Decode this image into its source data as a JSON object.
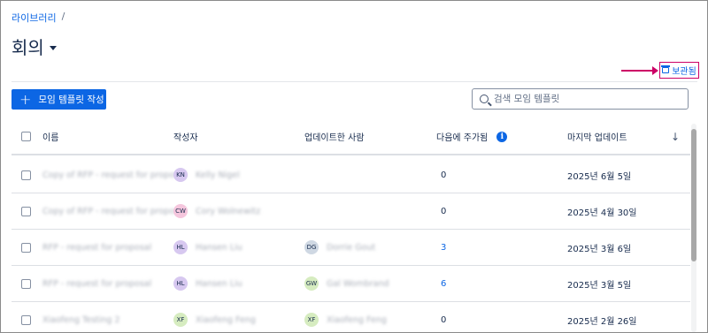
{
  "breadcrumb": {
    "library": "라이브러리",
    "separator": "/"
  },
  "page": {
    "title": "회의"
  },
  "archived": {
    "label": "보관됨"
  },
  "toolbar": {
    "create_label": "모임 템플릿 작성",
    "search_placeholder": "검색 모임 템플릿"
  },
  "table": {
    "headers": {
      "name": "이름",
      "author": "작성자",
      "updated_by": "업데이트한 사람",
      "next_added": "다음에 주가됨",
      "last_updated": "마지막 업데이트"
    },
    "rows": [
      {
        "name": "Copy of RFP - request for proposal",
        "author_initials": "KN",
        "author_color": "#d7c8f0",
        "author": "Kelly Nigel",
        "updater_initials": "",
        "updater_color": "",
        "updater": "",
        "count": "0",
        "count_link": false,
        "date": "2025년 6월 5일"
      },
      {
        "name": "Copy of RFP - request for proposal",
        "author_initials": "CW",
        "author_color": "#f5c6dd",
        "author": "Cory Wolnewitz",
        "updater_initials": "",
        "updater_color": "",
        "updater": "",
        "count": "0",
        "count_link": false,
        "date": "2025년 4월 30일"
      },
      {
        "name": "RFP - request for proposal",
        "author_initials": "HL",
        "author_color": "#d7c8f0",
        "author": "Hansen Liu",
        "updater_initials": "DG",
        "updater_color": "#cfd8e3",
        "updater": "Dorrie Gout",
        "count": "3",
        "count_link": true,
        "date": "2025년 3월 6일"
      },
      {
        "name": "RFP - request for proposal",
        "author_initials": "HL",
        "author_color": "#d7c8f0",
        "author": "Hansen Liu",
        "updater_initials": "GW",
        "updater_color": "#d6ecc0",
        "updater": "Gal Wombrand",
        "count": "6",
        "count_link": true,
        "date": "2025년 3월 5일"
      },
      {
        "name": "Xiaofeng Testing 2",
        "author_initials": "XF",
        "author_color": "#d6ecc0",
        "author": "Xiaofeng Feng",
        "updater_initials": "XF",
        "updater_color": "#d6ecc0",
        "updater": "Xiaofeng Feng",
        "count": "0",
        "count_link": false,
        "date": "2025년 2월 26일"
      }
    ]
  },
  "colors": {
    "accent": "#0c66e4",
    "annotation": "#cc0066"
  },
  "icons": {
    "archive": "archive-icon",
    "search": "search-icon",
    "info": "info-icon",
    "sort": "arrow-down-icon",
    "plus": "plus-icon"
  }
}
